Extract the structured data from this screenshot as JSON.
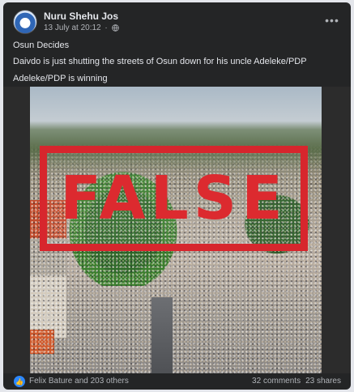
{
  "post": {
    "author": "Nuru Shehu Jos",
    "timestamp": "13 July at 20:12",
    "audience_icon": "globe-icon",
    "lines": [
      "Osun Decides",
      "Daivdo is just shutting the streets of Osun down for his uncle Adeleke/PDP",
      "Adeleke/PDP is winning"
    ],
    "stamp": "FALSE"
  },
  "footer": {
    "reaction_icon": "like-icon",
    "reactors": "Felix Bature and 203 others",
    "comments": "32 comments",
    "shares": "23 shares"
  },
  "colors": {
    "card_bg": "#242526",
    "stamp_red": "#d7262d",
    "like_blue": "#2d88ff"
  }
}
